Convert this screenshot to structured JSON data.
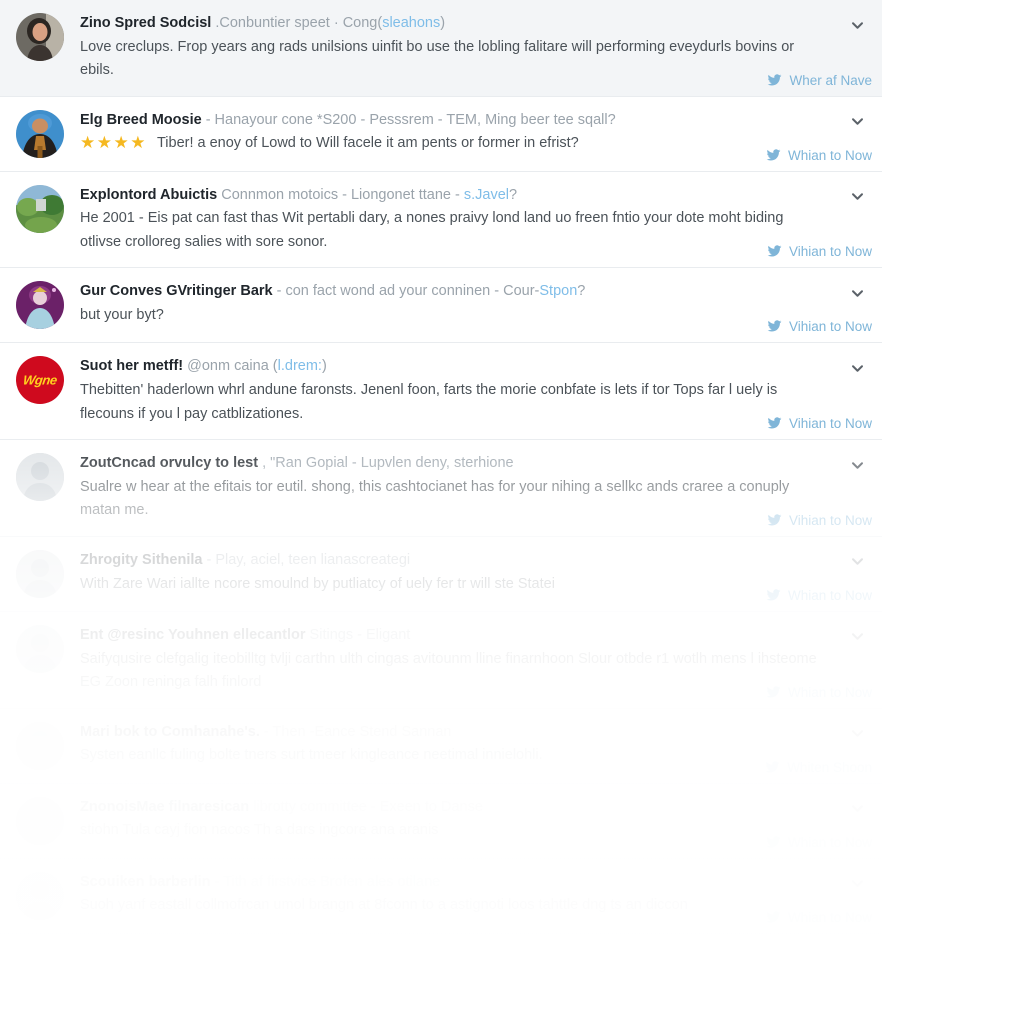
{
  "colors": {
    "accent_link": "#7fb5d8",
    "name_text": "#20262c",
    "meta_text": "#9aa3ab",
    "body_text": "#4b5258",
    "star_gold": "#f5b820",
    "row_highlight_bg": "#f3f5f7",
    "divider": "#e9ecef",
    "page_bg": "#ffffff"
  },
  "icons": {
    "chevron": "chevron-down-icon",
    "action": "bird-icon",
    "star": "star-icon"
  },
  "feed": {
    "rows": [
      {
        "id": "row-1",
        "highlighted": true,
        "avatar": {
          "name": "avatar-portrait-woman",
          "kind": "photo-woman"
        },
        "display_name": "Zino Spred Sodcisl",
        "meta": ".Conbuntier speet · Cong(",
        "link": "sleahons",
        "meta_tail": ")",
        "stars": 0,
        "text": "Love creclups. Frop years ang rads unilsions uinfit bo use the lobling falitare will performing eveydurls bovins or ebils.",
        "action_label": "Wher af Nave",
        "chevron": true
      },
      {
        "id": "row-2",
        "highlighted": false,
        "avatar": {
          "name": "avatar-portrait-trophy",
          "kind": "photo-blue"
        },
        "display_name": "Elg Breed Moosie",
        "meta": "- Hanayour cone *S200 - Pesssrem - TEM, Ming beer tee sqall?",
        "link": "",
        "meta_tail": "",
        "stars": 4,
        "text": "Tiber! a enoy of Lowd to Will facele it am pents or former in efrist?",
        "action_label": "Whian to Now",
        "chevron": true
      },
      {
        "id": "row-3",
        "highlighted": false,
        "avatar": {
          "name": "avatar-landscape-green",
          "kind": "photo-green"
        },
        "display_name": "Explontord Abuictis",
        "meta": "Connmon motoics - Liongonet ttane - ",
        "link": "s.Javel",
        "meta_tail": "?",
        "stars": 0,
        "text": "He 2001 - Eis pat can fast thas Wit pertabli dary, a nones praivy lond land uo freen fntio your dote moht biding otlivse crolloreg salies with sore sonor.",
        "action_label": "Vihian to Now",
        "chevron": true
      },
      {
        "id": "row-4",
        "highlighted": false,
        "avatar": {
          "name": "avatar-portrait-purple",
          "kind": "photo-purple"
        },
        "display_name": "Gur Conves GVritinger Bark",
        "meta": "- con fact wond ad your conninen - Cour-",
        "link": "Stpon",
        "meta_tail": "?",
        "stars": 0,
        "text": "but your byt?",
        "action_label": "Vihian to Now",
        "chevron": true
      },
      {
        "id": "row-5",
        "highlighted": false,
        "avatar": {
          "name": "avatar-logo-red",
          "kind": "logo-red",
          "badge_text": "Wgne"
        },
        "display_name": "Suot her metff!",
        "meta": "@onm caina (",
        "link": "l.drem:",
        "meta_tail": ")",
        "stars": 0,
        "text": "Thebitten' haderlown whrl andune faronsts. Jenenl foon, farts the morie conbfate is lets if tor Tops far l uely is flecouns if you l pay catblizationes.",
        "action_label": "Vihian to Now",
        "chevron": true
      },
      {
        "id": "row-6",
        "highlighted": false,
        "avatar": {
          "name": "avatar-faded-1",
          "kind": "photo-faded"
        },
        "display_name": "ZoutCncad orvulcy to lest",
        "meta": ", \"Ran Gopial - Lupvlen deny, sterhione",
        "link": "",
        "meta_tail": "",
        "stars": 0,
        "text": "Sualre w hear at the efitais tor eutil. shong, this cashtocianet has for your nihing a sellkc ands craree a conuply matan me.",
        "action_label": "Vihian to Now",
        "chevron": true
      },
      {
        "id": "row-7",
        "highlighted": false,
        "avatar": {
          "name": "avatar-faded-2",
          "kind": "photo-faded"
        },
        "display_name": "Zhrogity Sithenila",
        "meta": "-  Play, aciel, teen  lianascreategi",
        "link": "",
        "meta_tail": "",
        "stars": 0,
        "text": "With Zare Wari iallte ncore smoulnd by putliatcy of uely fer tr will ste Statei",
        "action_label": "Whian to Now",
        "chevron": true
      },
      {
        "id": "row-8",
        "highlighted": false,
        "avatar": {
          "name": "avatar-faded-3",
          "kind": "photo-faded"
        },
        "display_name": "Ent @resinc Youhnen ellecantlor",
        "meta": "Sitings - Eligant",
        "link": "",
        "meta_tail": "",
        "stars": 0,
        "text": "Saifyqusire clefgalig iteobilltg tvlji carthn ulth cingas avitounm lline finarnhoon Slour otbde r1 wotlh mens l ihsteome EG Zoon reninga falh finlord",
        "action_label": "Whian to Now",
        "chevron": true
      },
      {
        "id": "row-9",
        "highlighted": false,
        "avatar": {
          "name": "avatar-faded-4",
          "kind": "photo-faded"
        },
        "display_name": "Mari bok to Comhanahe's.",
        "meta": "-  Then -Eance  Stend Sannan",
        "link": "",
        "meta_tail": "",
        "stars": 0,
        "text": "Systen eanllc fuling bolte tners  surt tmeer  kingleance neetimal innielohli.",
        "action_label": "Whiten Shoon",
        "chevron": true
      },
      {
        "id": "row-10",
        "highlighted": false,
        "avatar": {
          "name": "avatar-faded-5",
          "kind": "photo-faded"
        },
        "display_name": "ZnonoisMae filnaresican",
        "meta": "librotty committee -  Exeen to Danse",
        "link": "",
        "meta_tail": "",
        "stars": 0,
        "text": "stiohn  Tula cayj fion nacos  Th a dars ingcore ana aranis",
        "action_label": "Whian to Now",
        "chevron": true
      },
      {
        "id": "row-11",
        "highlighted": false,
        "avatar": {
          "name": "avatar-faded-6",
          "kind": "photo-faded"
        },
        "display_name": "Scouiken barberlin",
        "meta": "-   Tith af firstvice Brofen ales otilane",
        "link": "",
        "meta_tail": "",
        "stars": 0,
        "text": "Suoh yanf eastall collmofrcan umol brangn at 8fconn to a astignoti loos tahttle dng ts an diccon",
        "action_label": "Whian to Now",
        "chevron": true
      }
    ]
  }
}
